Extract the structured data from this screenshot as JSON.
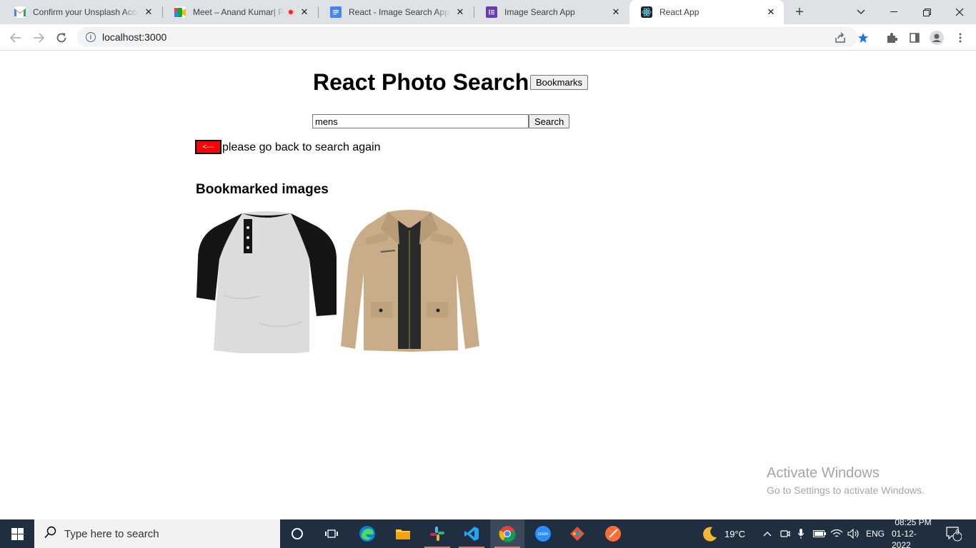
{
  "browser": {
    "tabs": [
      {
        "title": "Confirm your Unsplash Account",
        "icon": "gmail-icon",
        "color": "#ea4335"
      },
      {
        "title": "Meet – Anand Kumar| Pla",
        "icon": "meet-icon",
        "color": "#00832d"
      },
      {
        "title": "React - Image Search App - G",
        "icon": "docs-icon",
        "color": "#4285f4"
      },
      {
        "title": "Image Search App",
        "icon": "forms-icon",
        "color": "#673ab7"
      },
      {
        "title": "React App",
        "icon": "react-icon",
        "color": "#61dafb"
      }
    ],
    "url": "localhost:3000"
  },
  "page": {
    "title": "React Photo Search",
    "bookmarks_label": "Bookmarks",
    "search_value": "mens",
    "search_label": "Search",
    "back_label": "<---",
    "back_text": "please go back to search again",
    "bookmarked_heading": "Bookmarked images"
  },
  "watermark": {
    "line1": "Activate Windows",
    "line2": "Go to Settings to activate Windows."
  },
  "taskbar": {
    "search_placeholder": "Type here to search",
    "weather": "19°C",
    "lang": "ENG",
    "time": "08:25 PM",
    "date": "01-12-2022",
    "notifications": "9"
  }
}
